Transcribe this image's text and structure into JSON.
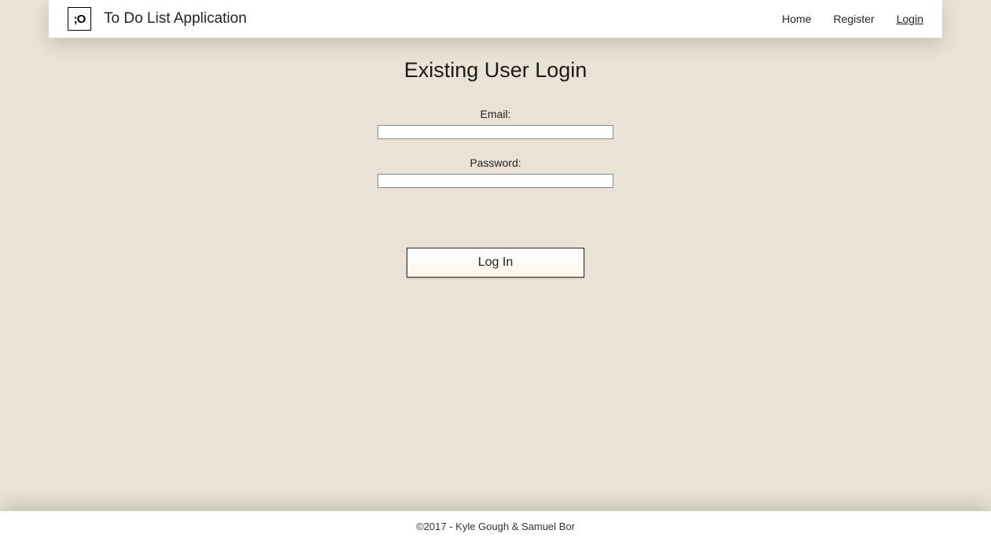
{
  "header": {
    "logo_text": ";O",
    "app_title": "To Do List Application",
    "nav": {
      "home": "Home",
      "register": "Register",
      "login": "Login"
    }
  },
  "page": {
    "heading": "Existing User Login",
    "email_label": "Email:",
    "email_value": "",
    "password_label": "Password:",
    "password_value": "",
    "login_button": "Log In"
  },
  "footer": {
    "text": "©2017 - Kyle Gough & Samuel Bor"
  }
}
